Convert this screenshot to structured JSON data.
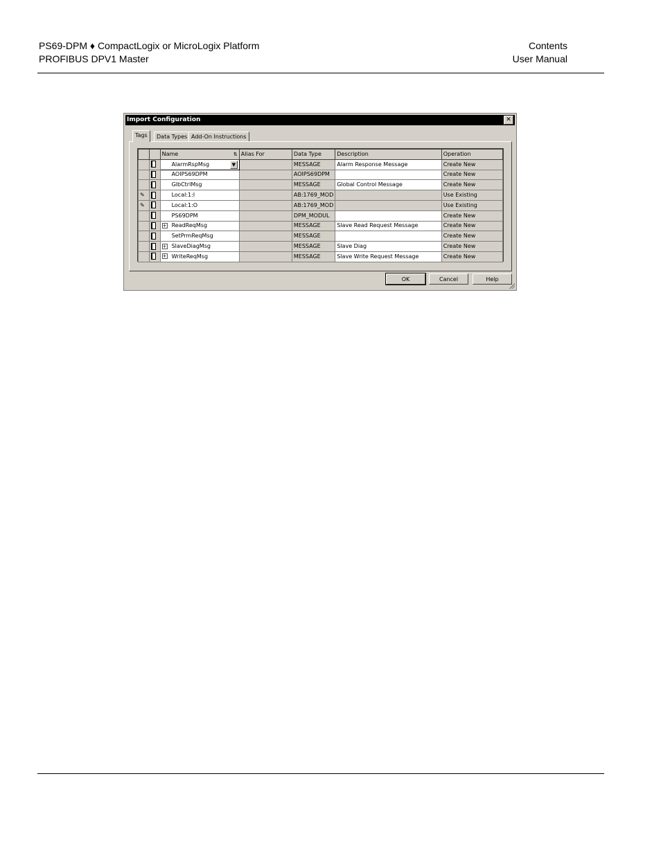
{
  "header": {
    "left_line1": "PS69-DPM ♦ CompactLogix or MicroLogix Platform",
    "left_line2": "PROFIBUS DPV1 Master",
    "right_line1": "Contents",
    "right_line2": "User Manual"
  },
  "dialog": {
    "title": "Import Configuration",
    "close_label": "✕",
    "tabs": [
      "Tags",
      "Data Types",
      "Add-On Instructions"
    ],
    "columns": [
      "Name",
      "Alias For",
      "Data Type",
      "Description",
      "Operation"
    ],
    "sort_icon": "sort-az-icon",
    "rows": [
      {
        "name": "AlarmRspMsg",
        "alias": "",
        "data_type": "MESSAGE",
        "description": "Alarm Response Message",
        "operation": "Create New",
        "expandable": false,
        "icon": "document-icon"
      },
      {
        "name": "AOIPS69DPM",
        "alias": "",
        "data_type": "AOIPS69DPM",
        "description": "",
        "operation": "Create New",
        "expandable": false,
        "icon": "document-icon"
      },
      {
        "name": "GlbCtrlMsg",
        "alias": "",
        "data_type": "MESSAGE",
        "description": "Global Control Message",
        "operation": "Create New",
        "expandable": false,
        "icon": "document-icon"
      },
      {
        "name": "Local:1:I",
        "alias": "",
        "data_type": "AB:1769_MOD",
        "description": "",
        "operation": "Use Existing",
        "expandable": false,
        "icon": "document-icon",
        "marker": "edit-icon"
      },
      {
        "name": "Local:1:O",
        "alias": "",
        "data_type": "AB:1769_MOD",
        "description": "",
        "operation": "Use Existing",
        "expandable": false,
        "icon": "document-icon",
        "marker": "edit-icon"
      },
      {
        "name": "PS69DPM",
        "alias": "",
        "data_type": "DPM_MODUL",
        "description": "",
        "operation": "Create New",
        "expandable": false,
        "icon": "document-icon"
      },
      {
        "name": "ReadReqMsg",
        "alias": "",
        "data_type": "MESSAGE",
        "description": "Slave Read Request Message",
        "operation": "Create New",
        "expandable": true,
        "icon": "document-icon"
      },
      {
        "name": "SetPrmReqMsg",
        "alias": "",
        "data_type": "MESSAGE",
        "description": "",
        "operation": "Create New",
        "expandable": false,
        "icon": "document-icon"
      },
      {
        "name": "SlaveDiagMsg",
        "alias": "",
        "data_type": "MESSAGE",
        "description": "Slave Diag",
        "operation": "Create New",
        "expandable": true,
        "icon": "document-icon"
      },
      {
        "name": "WriteReqMsg",
        "alias": "",
        "data_type": "MESSAGE",
        "description": "Slave Write Request Message",
        "operation": "Create New",
        "expandable": true,
        "icon": "document-icon"
      }
    ],
    "buttons": {
      "ok": "OK",
      "cancel": "Cancel",
      "help": "Help"
    }
  }
}
